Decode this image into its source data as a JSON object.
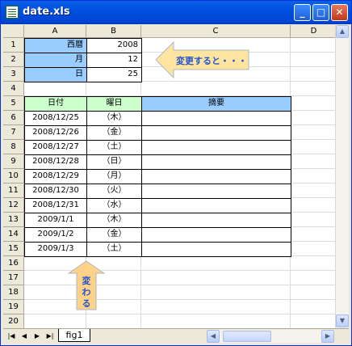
{
  "window": {
    "title": "date.xls",
    "minimize": "_",
    "maximize": "□",
    "close": "✕"
  },
  "columns": [
    "A",
    "B",
    "C",
    "D"
  ],
  "rows": [
    "1",
    "2",
    "3",
    "4",
    "5",
    "6",
    "7",
    "8",
    "9",
    "10",
    "11",
    "12",
    "13",
    "14",
    "15",
    "16",
    "17",
    "18",
    "19",
    "20"
  ],
  "inputs": {
    "year_label": "西暦",
    "year_value": "2008",
    "month_label": "月",
    "month_value": "12",
    "day_label": "日",
    "day_value": "25"
  },
  "table": {
    "headers": [
      "日付",
      "曜日",
      "摘要"
    ],
    "rows": [
      [
        "2008/12/25",
        "（木）",
        ""
      ],
      [
        "2008/12/26",
        "（金）",
        ""
      ],
      [
        "2008/12/27",
        "（土）",
        ""
      ],
      [
        "2008/12/28",
        "（日）",
        ""
      ],
      [
        "2008/12/29",
        "（月）",
        ""
      ],
      [
        "2008/12/30",
        "（火）",
        ""
      ],
      [
        "2008/12/31",
        "（水）",
        ""
      ],
      [
        "2009/1/1",
        "（木）",
        ""
      ],
      [
        "2009/1/2",
        "（金）",
        ""
      ],
      [
        "2009/1/3",
        "（土）",
        ""
      ]
    ]
  },
  "callouts": {
    "left_arrow": "変更すると・・・",
    "up_arrow": "変わる"
  },
  "colors": {
    "input_fill": "#99ccff",
    "header_fill": "#ccffcc",
    "arrow_fill": "#ffe4a0",
    "arrow_text": "#2255cc"
  },
  "sheet_tabs": {
    "nav": [
      "|◀",
      "◀",
      "▶",
      "▶|"
    ],
    "active_tab": "fig1"
  }
}
